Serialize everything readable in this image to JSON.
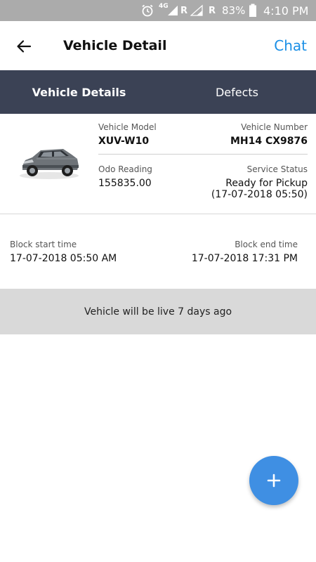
{
  "status_bar": {
    "alarm_icon": "alarm-clock-icon",
    "network_label": "4G",
    "roaming_1": "R",
    "roaming_2": "R",
    "battery_percent": "83%",
    "time": "4:10 PM"
  },
  "app_bar": {
    "back_icon": "arrow-left-icon",
    "title": "Vehicle Detail",
    "chat_label": "Chat"
  },
  "tabs": [
    {
      "label": "Vehicle Details",
      "active": true
    },
    {
      "label": "Defects",
      "active": false
    }
  ],
  "vehicle": {
    "image_icon": "suv-car-icon",
    "model_label": "Vehicle Model",
    "model_value": "XUV-W10",
    "number_label": "Vehicle Number",
    "number_value": "MH14 CX9876",
    "odo_label": "Odo Reading",
    "odo_value": "155835.00",
    "status_label": "Service Status",
    "status_value": "Ready for Pickup",
    "status_time": "(17-07-2018 05:50)"
  },
  "block": {
    "start_label": "Block start time",
    "start_value": "17-07-2018 05:50 AM",
    "end_label": "Block end time",
    "end_value": "17-07-2018 17:31 PM"
  },
  "banner": {
    "text": "Vehicle will be live 7 days ago"
  },
  "fab": {
    "icon": "plus-icon",
    "label": "+"
  },
  "colors": {
    "status_bar": "#ababab",
    "tab_bar": "#3b4255",
    "accent_blue": "#1a8fe6",
    "fab": "#3f8fe3",
    "banner": "#d9d9d9"
  }
}
